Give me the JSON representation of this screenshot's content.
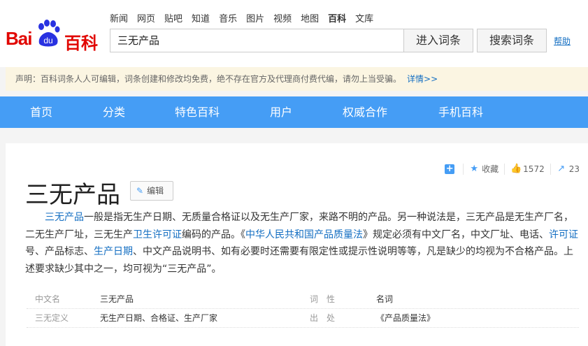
{
  "logo": {
    "text_left": "Bai",
    "text_paw": "du",
    "text_right": "百科"
  },
  "products": [
    "新闻",
    "网页",
    "贴吧",
    "知道",
    "音乐",
    "图片",
    "视频",
    "地图",
    "百科",
    "文库"
  ],
  "active_product": "百科",
  "search": {
    "value": "三无产品",
    "enter_label": "进入词条",
    "search_label": "搜索词条",
    "help": "帮助"
  },
  "notice": {
    "text": "声明：百科词条人人可编辑，词条创建和修改均免费，绝不存在官方及代理商付费代编，请勿上当受骗。",
    "link": "详情>>"
  },
  "nav": [
    "首页",
    "分类",
    "特色百科",
    "用户",
    "权威合作",
    "手机百科"
  ],
  "tools": {
    "collect": "收藏",
    "likes": "1572",
    "shares": "23"
  },
  "title": "三无产品",
  "edit_label": "编辑",
  "paragraph": [
    {
      "t": "三无产品",
      "link": true
    },
    {
      "t": "一般是指无生产日期、无质量合格证以及无生产厂家，来路不明的产品。另一种说法是，三无产品是无生产厂名，二无生产厂址，三无生产"
    },
    {
      "t": "卫生许可证",
      "link": true
    },
    {
      "t": "编码的产品。《"
    },
    {
      "t": "中华人民共和国产品质量法",
      "link": true
    },
    {
      "t": "》规定必须有中文厂名，中文厂址、电话、"
    },
    {
      "t": "许可证",
      "link": true
    },
    {
      "t": "号、产品标志、"
    },
    {
      "t": "生产日期",
      "link": true
    },
    {
      "t": "、中文产品说明书、如有必要时还需要有限定性或提示性说明等等，凡是缺少的均视为不合格产品。上述要求缺少其中之一，均可视为“三无产品”。"
    }
  ],
  "basic_info": [
    {
      "k1": "中文名",
      "v1": "三无产品",
      "k2": "词　性",
      "v2": "名词"
    },
    {
      "k1": "三无定义",
      "v1": "无生产日期、合格证、生产厂家",
      "k2": "出　处",
      "v2": "《产品质量法》"
    }
  ]
}
